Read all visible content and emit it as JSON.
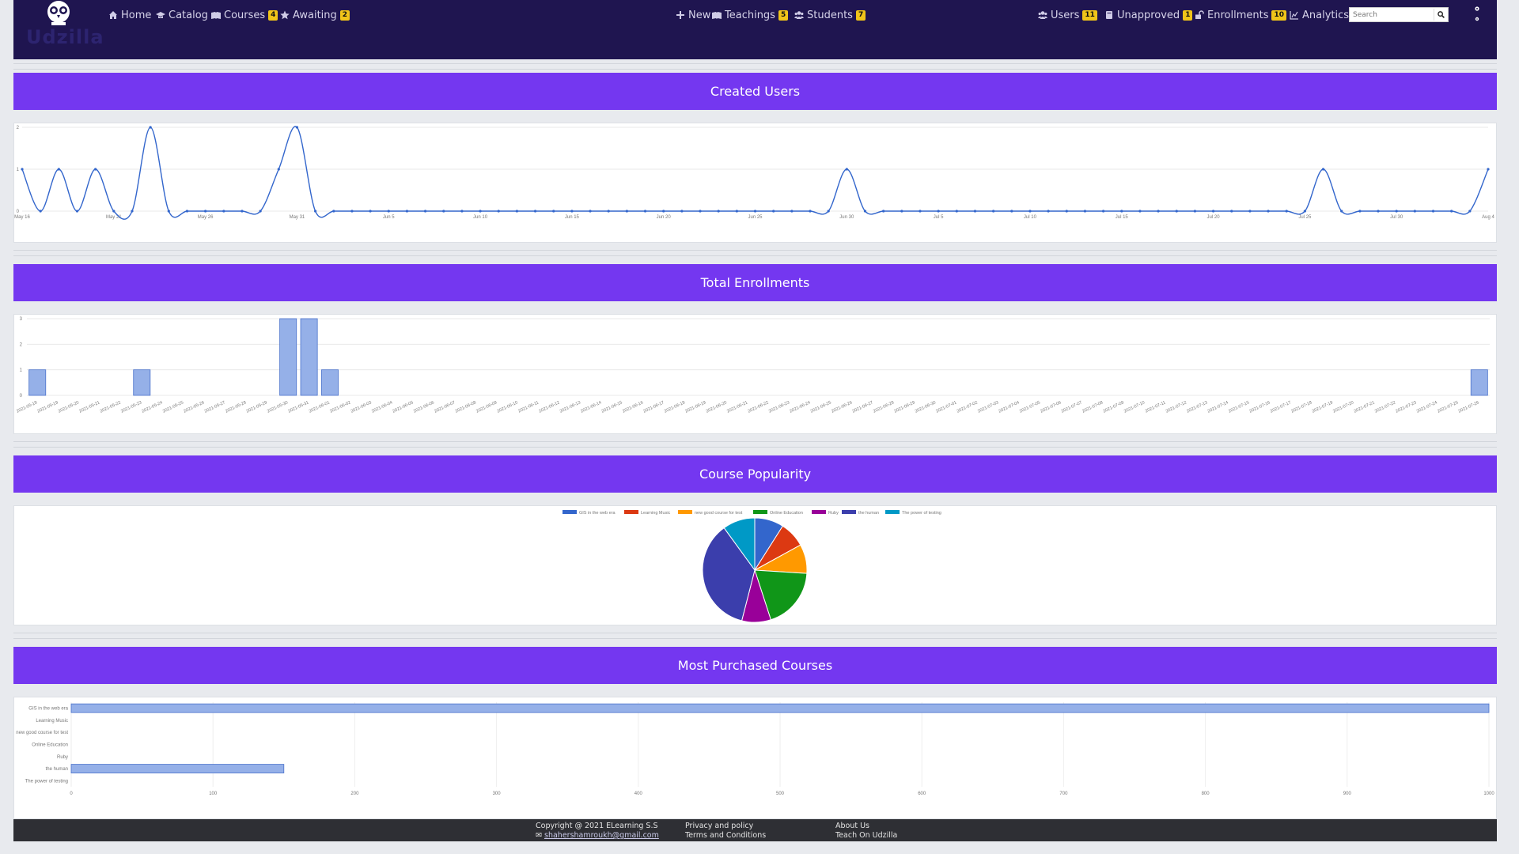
{
  "nav": {
    "brand": "Udzilla",
    "left": [
      {
        "icon": "home-icon",
        "label": "Home",
        "badge": null
      },
      {
        "icon": "graduation-cap-icon",
        "label": "Catalog",
        "badge": null
      },
      {
        "icon": "book-open-icon",
        "label": "Courses",
        "badge": "4"
      },
      {
        "icon": "star-icon",
        "label": "Awaiting",
        "badge": "2"
      }
    ],
    "center": [
      {
        "icon": "plus-icon",
        "label": "New",
        "badge": null
      },
      {
        "icon": "book-open-icon",
        "label": "Teachings",
        "badge": "5"
      },
      {
        "icon": "users-icon",
        "label": "Students",
        "badge": "7"
      }
    ],
    "right": [
      {
        "icon": "users-icon",
        "label": "Users",
        "badge": "11"
      },
      {
        "icon": "book-icon",
        "label": "Unapproved",
        "badge": "1"
      },
      {
        "icon": "unlock-icon",
        "label": "Enrollments",
        "badge": "10"
      },
      {
        "icon": "chart-line-icon",
        "label": "Analytics",
        "badge": null
      }
    ],
    "search_placeholder": "Search"
  },
  "sections": {
    "created_users": "Created Users",
    "total_enrollments": "Total Enrollments",
    "course_popularity": "Course Popularity",
    "most_purchased": "Most Purchased Courses"
  },
  "colors": {
    "navbar": "#1f1550",
    "section_bar": "#7437f0",
    "badge": "#f0c419",
    "line": "#3366cc",
    "bar_fill": "#95b0e8",
    "bar_stroke": "#4a72cc"
  },
  "chart_data": [
    {
      "type": "line",
      "title": "Created Users",
      "x_start": "2021-05-16",
      "x_end": "2021-08-04",
      "xticks": [
        "May 16",
        "May 21",
        "May 26",
        "May 31",
        "Jun 5",
        "Jun 10",
        "Jun 15",
        "Jun 20",
        "Jun 25",
        "Jun 30",
        "Jul 5",
        "Jul 10",
        "Jul 15",
        "Jul 20",
        "Jul 25",
        "Jul 30",
        "Aug 4"
      ],
      "ylim": [
        0,
        2
      ],
      "yticks": [
        "0",
        "1",
        "2"
      ],
      "points": [
        {
          "x": "2021-05-16",
          "y": 1
        },
        {
          "x": "2021-05-18",
          "y": 1
        },
        {
          "x": "2021-05-20",
          "y": 1
        },
        {
          "x": "2021-05-23",
          "y": 2
        },
        {
          "x": "2021-05-30",
          "y": 1
        },
        {
          "x": "2021-05-31",
          "y": 2
        },
        {
          "x": "2021-06-30",
          "y": 1
        },
        {
          "x": "2021-07-26",
          "y": 1
        },
        {
          "x": "2021-08-04",
          "y": 1
        }
      ],
      "grid": true
    },
    {
      "type": "bar",
      "title": "Total Enrollments",
      "x_start": "2021-05-18",
      "x_end": "2021-07-26",
      "ylim": [
        0,
        3
      ],
      "yticks": [
        "0",
        "1",
        "2",
        "3"
      ],
      "points": [
        {
          "x": "2021-05-18",
          "y": 1
        },
        {
          "x": "2021-05-23",
          "y": 1
        },
        {
          "x": "2021-05-30",
          "y": 3
        },
        {
          "x": "2021-05-31",
          "y": 3
        },
        {
          "x": "2021-06-01",
          "y": 1
        },
        {
          "x": "2021-07-26",
          "y": 1
        }
      ],
      "grid": true
    },
    {
      "type": "pie",
      "title": "Course Popularity",
      "legend_position": "top",
      "labels": [
        "GIS in the web era",
        "Learning Music",
        "new good course for test",
        "Online Education",
        "Ruby",
        "the human",
        "The power of testing"
      ],
      "values": [
        9,
        8,
        9,
        19,
        9,
        36,
        10
      ],
      "colors": [
        "#3366cc",
        "#dc3912",
        "#ff9900",
        "#109618",
        "#990099",
        "#3b3eac",
        "#0099c6"
      ]
    },
    {
      "type": "bar",
      "orientation": "horizontal",
      "title": "Most Purchased Courses",
      "categories": [
        "GIS in the web era",
        "Learning Music",
        "new good course for test",
        "Online Education",
        "Ruby",
        "the human",
        "The power of testing"
      ],
      "values": [
        1000,
        0,
        0,
        0,
        0,
        150,
        0
      ],
      "xlim": [
        0,
        1000
      ],
      "xticks": [
        "0",
        "100",
        "200",
        "300",
        "400",
        "500",
        "600",
        "700",
        "800",
        "900",
        "1000"
      ],
      "grid": true
    }
  ],
  "footer": {
    "copyright": "Copyright @ 2021 ELearning S.S",
    "email": "shahershamroukh@gmail.com",
    "privacy": "Privacy and policy",
    "terms": "Terms and Conditions",
    "about": "About Us",
    "teach": "Teach On Udzilla"
  }
}
